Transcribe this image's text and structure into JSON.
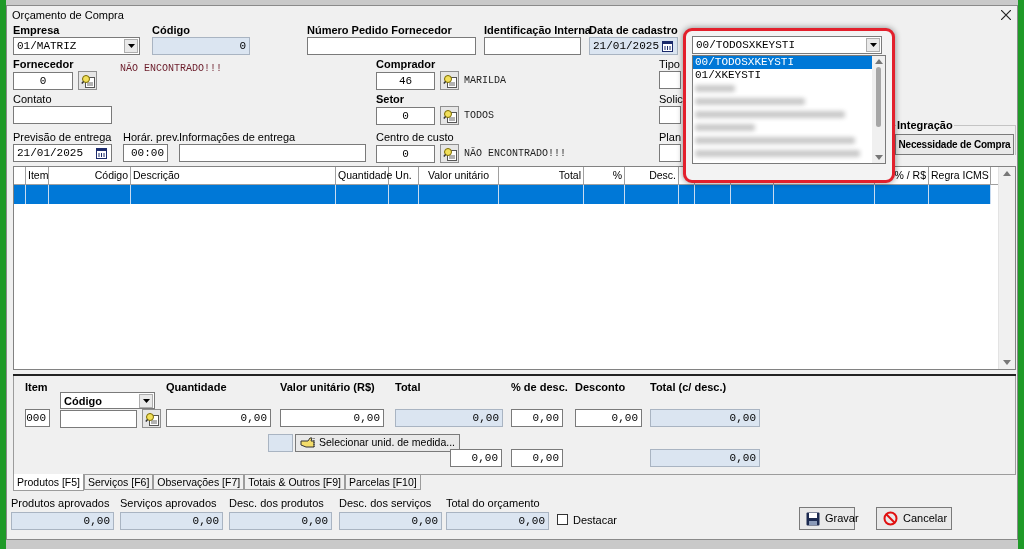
{
  "window": {
    "title": "Orçamento de Compra"
  },
  "form_rows": [
    {
      "items": [
        {
          "kind": "combo",
          "label": "Empresa",
          "bold": true,
          "value": "01/MATRIZ",
          "disabled": false
        },
        {
          "kind": "number",
          "label": "Código",
          "bold": true,
          "value": "0",
          "disabled": true
        },
        {
          "kind": "text",
          "label": "Número Pedido Fornecedor",
          "bold": true,
          "disabled": false
        },
        {
          "kind": "text",
          "label": "Identificação Interna",
          "bold": true,
          "disabled": false
        },
        {
          "kind": "date",
          "label": "Data de cadastro",
          "bold": true,
          "value": "21/01/2025",
          "disabled": true
        }
      ]
    },
    {
      "items": [
        {
          "kind": "lookup",
          "label": "Fornecedor",
          "bold": true,
          "value": "0",
          "disabled": false
        },
        {
          "kind": "message",
          "text": "NÃO ENCONTRADO!!!"
        },
        {
          "kind": "lookup",
          "label": "Comprador",
          "bold": true,
          "value": "46",
          "note": "MARILDA",
          "disabled": false
        },
        {
          "kind": "text",
          "label": "Tipo",
          "bold": false,
          "disabled": false
        }
      ]
    },
    {
      "items": [
        {
          "kind": "text",
          "label": "Contato",
          "bold": false,
          "disabled": false
        },
        {
          "kind": "lookup",
          "label": "Setor",
          "bold": true,
          "value": "0",
          "note": "TODOS",
          "disabled": false
        },
        {
          "kind": "text",
          "label": "Solic",
          "bold": false,
          "disabled": false
        }
      ]
    },
    {
      "items": [
        {
          "kind": "date",
          "label": "Previsão de entrega",
          "bold": false,
          "value": "21/01/2025",
          "disabled": false
        },
        {
          "kind": "number",
          "label": "Horár. prev.",
          "bold": false,
          "value": "00:00",
          "disabled": false
        },
        {
          "kind": "text",
          "label": "Informações de entrega",
          "bold": false,
          "disabled": false
        },
        {
          "kind": "lookup",
          "label": "Centro de custo",
          "bold": false,
          "value": "0",
          "note": "NÃO ENCONTRADO!!!",
          "disabled": false
        },
        {
          "kind": "text",
          "label": "Plan",
          "bold": false,
          "disabled": false
        },
        {
          "kind": "group",
          "label": "Integração",
          "button": "Necessidade de Compra"
        }
      ]
    }
  ],
  "popup": {
    "value": "00/TODOSXKEYSTI",
    "items": [
      {
        "kind": "entry",
        "text": "00/TODOSXKEYSTI",
        "selected": true
      },
      {
        "kind": "entry",
        "text": "01/XKEYSTI",
        "selected": false
      },
      {
        "kind": "blurred",
        "selected": false
      },
      {
        "kind": "blurred",
        "selected": false
      },
      {
        "kind": "blurred",
        "selected": false
      },
      {
        "kind": "blurred",
        "selected": false
      },
      {
        "kind": "blurred",
        "selected": false
      },
      {
        "kind": "blurred",
        "selected": false
      }
    ]
  },
  "grid": {
    "columns": [
      {
        "label": "Item"
      },
      {
        "label": "Código"
      },
      {
        "label": "Descrição"
      },
      {
        "label": "Quantidade"
      },
      {
        "label": "Un."
      },
      {
        "label": "Valor unitário"
      },
      {
        "label": "Total"
      },
      {
        "label": "%"
      },
      {
        "label": "Desc."
      },
      {
        "kind": "blank"
      },
      {
        "kind": "blank"
      },
      {
        "kind": "blank"
      },
      {
        "kind": "blank"
      },
      {
        "label": "% / R$"
      },
      {
        "label": "Regra ICMS"
      }
    ],
    "rows": [
      {
        "selected": true
      }
    ]
  },
  "entry": {
    "rows": [
      {
        "items": [
          {
            "kind": "number",
            "label": "Item",
            "value": "000",
            "disabled": false
          },
          {
            "kind": "lookup",
            "selector": "Código",
            "disabled": false
          },
          {
            "kind": "number",
            "label": "Quantidade",
            "value": "0,00",
            "disabled": false
          },
          {
            "kind": "number",
            "label": "Valor unitário (R$)",
            "value": "0,00",
            "disabled": false
          },
          {
            "kind": "number",
            "label": "Total",
            "value": "0,00",
            "disabled": true
          },
          {
            "kind": "number",
            "label": "% de desc.",
            "value": "0,00",
            "disabled": false
          },
          {
            "kind": "number",
            "label": "Desconto",
            "value": "0,00",
            "disabled": false
          },
          {
            "kind": "number",
            "label": "Total (c/ desc.)",
            "value": "0,00",
            "disabled": true
          }
        ]
      },
      {
        "items": [
          {
            "kind": "text",
            "disabled": true
          },
          {
            "kind": "button",
            "text": "Selecionar unid. de medida..."
          },
          {
            "kind": "number",
            "value": "0,00",
            "disabled": false
          },
          {
            "kind": "number",
            "value": "0,00",
            "disabled": false
          },
          {
            "kind": "number",
            "value": "0,00",
            "disabled": true
          }
        ]
      }
    ]
  },
  "tabs": [
    {
      "label": "Produtos [F5]",
      "selected": true
    },
    {
      "label": "Serviços [F6]",
      "selected": false
    },
    {
      "label": "Observações [F7]",
      "selected": false
    },
    {
      "label": "Totais & Outros [F9]",
      "selected": false
    },
    {
      "label": "Parcelas [F10]",
      "selected": false
    }
  ],
  "totals": [
    {
      "label": "Produtos aprovados",
      "value": "0,00"
    },
    {
      "label": "Serviços aprovados",
      "value": "0,00"
    },
    {
      "label": "Desc. dos produtos",
      "value": "0,00"
    },
    {
      "label": "Desc. dos serviços",
      "value": "0,00"
    },
    {
      "label": "Total do orçamento",
      "value": "0,00"
    }
  ],
  "destacar": {
    "label": "Destacar",
    "checked": false
  },
  "buttons": [
    {
      "kind": "save",
      "label": "Gravar"
    },
    {
      "kind": "cancel",
      "label": "Cancelar"
    }
  ]
}
